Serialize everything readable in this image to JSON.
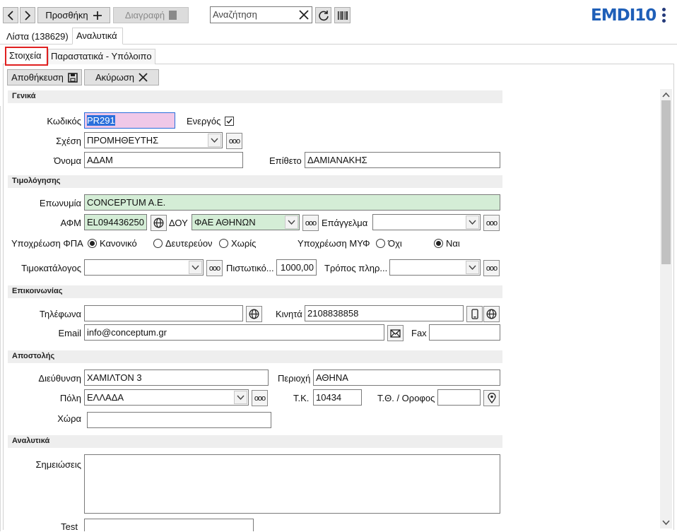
{
  "toolbar": {
    "add_label": "Προσθήκη",
    "delete_label": "Διαγραφή",
    "search_placeholder": "Αναζήτηση",
    "logo_text": "EMDI10"
  },
  "tabs": {
    "list": "Λίστα (138629)",
    "details": "Αναλυτικά",
    "sub_info": "Στοιχεία",
    "sub_docs": "Παραστατικά - Υπόλοιπο"
  },
  "actions": {
    "save": "Αποθήκευση",
    "cancel": "Ακύρωση"
  },
  "sections": {
    "general": "Γενικά",
    "billing": "Τιμολόγησης",
    "contact": "Επικοινωνίας",
    "shipping": "Αποστολής",
    "details": "Αναλυτικά"
  },
  "labels": {
    "code": "Κωδικός",
    "active": "Ενεργός",
    "relation": "Σχέση",
    "first_name": "Όνομα",
    "last_name": "Επίθετο",
    "company_name": "Επωνυμία",
    "vat": "ΑΦΜ",
    "tax_office": "ΔΟΥ",
    "profession": "Επάγγελμα",
    "vat_obligation": "Υποχρέωση ΦΠΑ",
    "vat_normal": "Κανονικό",
    "vat_secondary": "Δευτερεύον",
    "vat_none": "Χωρίς",
    "myf_obligation": "Υποχρέωση ΜΥΦ",
    "no": "Όχι",
    "yes": "Ναι",
    "price_list": "Τιμοκατάλογος",
    "credit": "Πιστωτικό...",
    "payment": "Τρόπος πληρ...",
    "phones": "Τηλέφωνα",
    "mobile": "Κινητά",
    "email": "Email",
    "fax": "Fax",
    "address": "Διεύθυνση",
    "area": "Περιοχή",
    "city": "Πόλη",
    "postal": "Τ.Κ.",
    "po_floor": "Τ.Θ. / Οροφος",
    "country": "Χώρα",
    "notes": "Σημειώσεις",
    "test": "Test"
  },
  "values": {
    "code": "PR291",
    "relation": "ΠΡΟΜΗΘΕΥΤΗΣ",
    "first_name": "ΑΔΑΜ",
    "last_name": "ΔΑΜΙΑΝΑΚΗΣ",
    "company_name": "CONCEPTUM A.E.",
    "vat": "EL094436250",
    "tax_office": "ΦΑΕ ΑΘΗΝΩΝ",
    "profession": "",
    "price_list": "",
    "credit": "1000,00",
    "payment": "",
    "phones": "",
    "mobile": "2108838858",
    "email": "info@conceptum.gr",
    "fax": "",
    "address": "ΧΑΜΙΛΤΟΝ 3",
    "area": "ΑΘΗΝΑ",
    "city": "ΕΛΛΑΔΑ",
    "postal": "10434",
    "po_floor": "",
    "country": "",
    "notes": "",
    "test": ""
  },
  "state": {
    "active_checked": true,
    "vat_obligation": "Κανονικό",
    "myf_obligation": "Ναι"
  },
  "colors": {
    "highlight_border": "#e02020",
    "required_field": "#d4edd6",
    "focused_field": "#f0c8e8",
    "logo_blue": "#1f5fb8",
    "logo_navy": "#243a7a"
  }
}
